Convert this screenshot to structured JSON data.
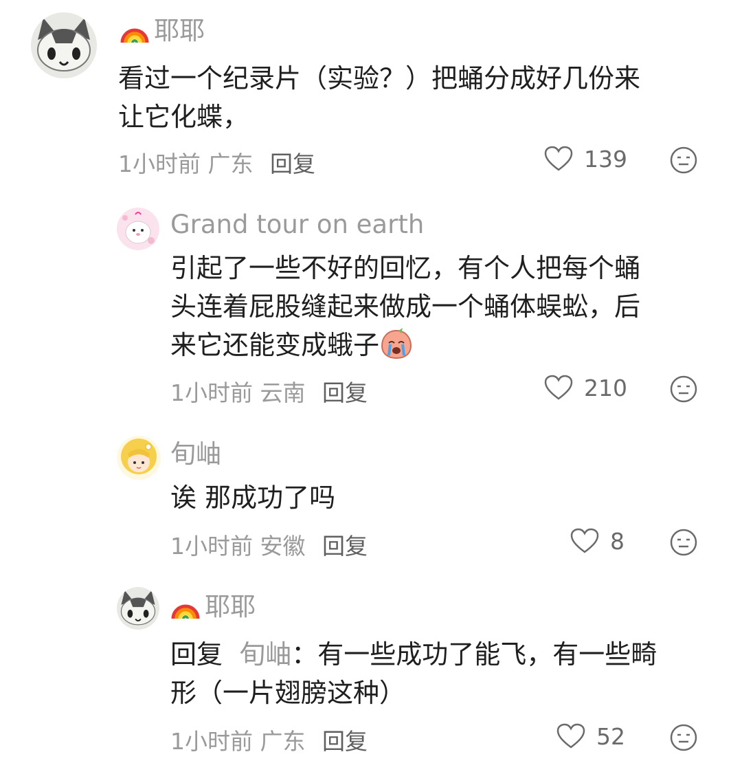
{
  "comments": [
    {
      "author": "耶耶",
      "text_lines": [
        "看过一个纪录片（实验？）把蛹分成好几份来",
        "让它化蝶，"
      ],
      "time": "1小时前",
      "location": "广东",
      "reply_label": "回复",
      "likes": "139",
      "avatar_icon": "cat-avatar",
      "author_badge_icon": "rainbow-icon"
    },
    {
      "author": "Grand tour on earth",
      "text_lines": [
        "引起了一些不好的回忆，有个人把每个蛹",
        "头连着屁股缝起来做成一个蛹体蜈蚣，后",
        "来它还能变成蛾子"
      ],
      "trailing_emoji": "crying-face-emoji",
      "time": "1小时前",
      "location": "云南",
      "reply_label": "回复",
      "likes": "210",
      "avatar_icon": "seal-avatar"
    },
    {
      "author": "旬岫",
      "text_lines": [
        "诶 那成功了吗"
      ],
      "time": "1小时前",
      "location": "安徽",
      "reply_label": "回复",
      "likes": "8",
      "avatar_icon": "blonde-girl-avatar"
    },
    {
      "author": "耶耶",
      "reply_prefix": "回复",
      "reply_to": "旬岫",
      "text_lines": [
        "：有一些成功了能飞，有一些畸",
        "形（一片翅膀这种）"
      ],
      "time": "1小时前",
      "location": "广东",
      "reply_label": "回复",
      "likes": "52",
      "avatar_icon": "cat-avatar",
      "author_badge_icon": "rainbow-icon"
    }
  ],
  "colors": {
    "text": "#1f1f1f",
    "muted": "#9a9a9a",
    "icon": "#6a6a6a"
  }
}
